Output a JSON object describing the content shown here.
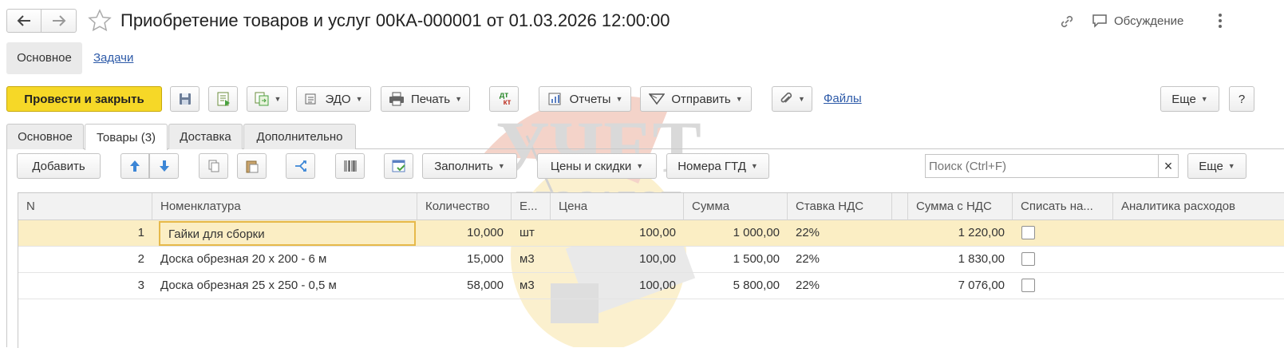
{
  "window": {
    "title": "Приобретение товаров и услуг 00КА-000001 от 01.03.2026 12:00:00",
    "discussion_label": "Обсуждение"
  },
  "nav_tabs": {
    "main": "Основное",
    "tasks": "Задачи"
  },
  "toolbar": {
    "post_close": "Провести и закрыть",
    "edo": "ЭДО",
    "print": "Печать",
    "dt_kt_top": "дт",
    "dt_kt_bottom": "кт",
    "reports": "Отчеты",
    "send": "Отправить",
    "files": "Файлы",
    "more": "Еще",
    "help": "?"
  },
  "doc_tabs": [
    "Основное",
    "Товары (3)",
    "Доставка",
    "Дополнительно"
  ],
  "table_toolbar": {
    "add": "Добавить",
    "fill": "Заполнить",
    "prices": "Цены и скидки",
    "gtd": "Номера ГТД",
    "search_placeholder": "Поиск (Ctrl+F)",
    "clear": "×",
    "more": "Еще"
  },
  "table": {
    "columns": [
      "N",
      "Номенклатура",
      "Количество",
      "Е...",
      "Цена",
      "Сумма",
      "Ставка НДС",
      "",
      "Сумма с НДС",
      "Списать на...",
      "Аналитика расходов"
    ],
    "rows": [
      {
        "n": "1",
        "item": "Гайки для сборки",
        "qty": "10,000",
        "unit": "шт",
        "price": "100,00",
        "sum": "1 000,00",
        "vat": "22%",
        "total": "1 220,00"
      },
      {
        "n": "2",
        "item": "Доска обрезная 20 х 200 - 6 м",
        "qty": "15,000",
        "unit": "м3",
        "price": "100,00",
        "sum": "1 500,00",
        "vat": "22%",
        "total": "1 830,00"
      },
      {
        "n": "3",
        "item": "Доска обрезная 25 х 250 - 0,5 м",
        "qty": "58,000",
        "unit": "м3",
        "price": "100,00",
        "sum": "5 800,00",
        "vat": "22%",
        "total": "7 076,00"
      }
    ]
  },
  "watermark": {
    "line1": "УЧЕТ",
    "line2": "БЕЗ ЗАБОТ"
  },
  "colors": {
    "accent_yellow": "#f6d827",
    "selected_row": "#fbeec4",
    "link": "#2d5aa8"
  }
}
